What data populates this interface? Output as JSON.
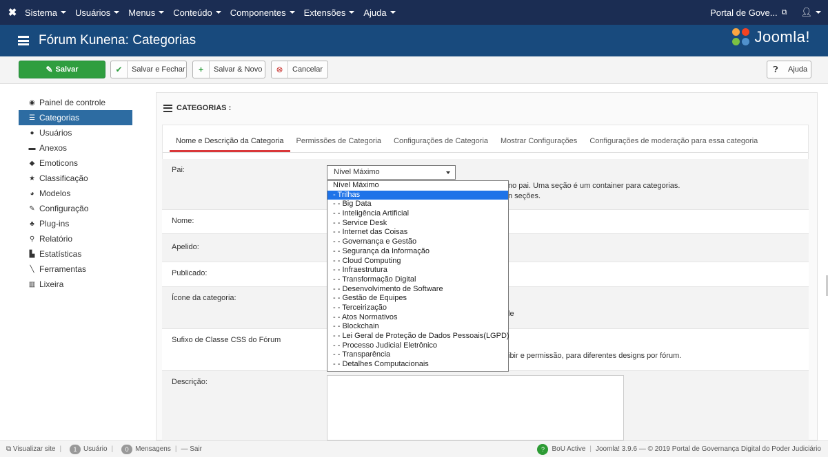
{
  "topnav": {
    "menus": [
      "Sistema",
      "Usuários",
      "Menus",
      "Conteúdo",
      "Componentes",
      "Extensões",
      "Ajuda"
    ],
    "portal": "Portal de Gove..."
  },
  "header": {
    "title": "Fórum Kunena: Categorias",
    "brand": "Joomla!"
  },
  "toolbar": {
    "save": "Salvar",
    "save_close": "Salvar e Fechar",
    "save_new": "Salvar & Novo",
    "cancel": "Cancelar",
    "help": "Ajuda"
  },
  "sidebar": {
    "items": [
      "Painel de controle",
      "Categorias",
      "Usuários",
      "Anexos",
      "Emoticons",
      "Classificação",
      "Modelos",
      "Configuração",
      "Plug-ins",
      "Relatório",
      "Estatísticas",
      "Ferramentas",
      "Lixeira"
    ],
    "active_index": 1
  },
  "panel": {
    "title": "CATEGORIAS :"
  },
  "tabs": [
    "Nome e Descrição da Categoria",
    "Permissões de Categoria",
    "Configurações de Categoria",
    "Mostrar Configurações",
    "Configurações de moderação para essa categoria"
  ],
  "form": {
    "pai_label": "Pai:",
    "pai_help1": "no pai. Uma seção é um container para categorias.",
    "pai_help2": "n seções.",
    "nome_label": "Nome:",
    "apelido_label": "Apelido:",
    "publicado_label": "Publicado:",
    "icone_label": "Ícone da categoria:",
    "icone_help": "le",
    "sufixo_label": "Sufixo de Classe CSS do Fórum",
    "sufixo_help": "ibir e permissão, para diferentes designs por fórum.",
    "descricao_label": "Descrição:"
  },
  "select": {
    "value": "Nível Máximo",
    "options": [
      "Nível Máximo",
      "- Trilhas",
      "- - Big Data",
      "- - Inteligência Artificial",
      "- - Service Desk",
      "- - Internet das Coisas",
      "- - Governança e Gestão",
      "- - Segurança da Informação",
      "- - Cloud Computing",
      "- - Infraestrutura",
      "- - Transformação Digital",
      "- - Desenvolvimento de Software",
      "- - Gestão de Equipes",
      "- - Terceirização",
      "- - Atos Normativos",
      "- - Blockchain",
      "- - Lei Geral de Proteção de Dados Pessoais(LGPD)",
      "- - Processo Judicial Eletrônico",
      "- - Transparência",
      "- - Detalhes Computacionais"
    ],
    "highlighted_index": 1
  },
  "footer": {
    "view_site": "Visualizar site",
    "users_count": "1",
    "users_label": "Usuário",
    "messages_count": "0",
    "messages_label": "Mensagens",
    "logout": "Sair",
    "bou": "BoU Active",
    "version": "Joomla! 3.9.6 — © 2019 Portal de Governança Digital do Poder Judiciário"
  }
}
